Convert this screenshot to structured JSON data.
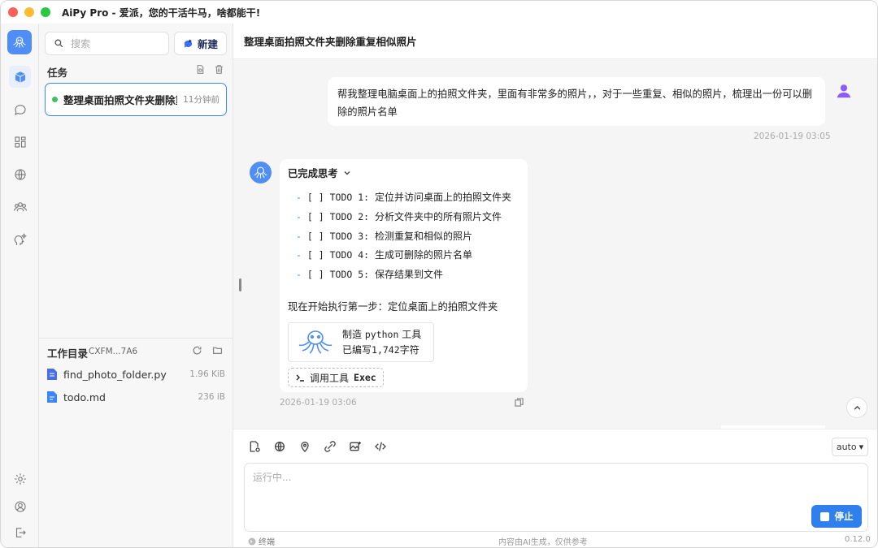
{
  "app": {
    "title": "AiPy Pro - 爱派，您的干活牛马，啥都能干!"
  },
  "sidebar": {
    "search_placeholder": "搜索",
    "new_label": "新建",
    "tasks_title": "任务",
    "tasks": [
      {
        "name": "整理桌面拍照文件夹删除重复相似照片",
        "time": "11分钟前",
        "status_color": "#3fbf5f"
      }
    ],
    "workdir": {
      "title": "工作目录",
      "path": "CXFM...7A6",
      "files": [
        {
          "name": "find_photo_folder.py",
          "size": "1.96 KiB"
        },
        {
          "name": "todo.md",
          "size": "236 iB"
        }
      ]
    }
  },
  "chat": {
    "title": "整理桌面拍照文件夹删除重复相似照片",
    "user_message": {
      "text": "帮我整理电脑桌面上的拍照文件夹，里面有非常多的照片，，对于一些重复、相似的照片，梳理出一份可以删除的照片名单",
      "timestamp": "2026-01-19 03:05"
    },
    "ai_message": {
      "thinking_label": "已完成思考",
      "todos": [
        {
          "prefix": "TODO 1:",
          "text": "定位并访问桌面上的拍照文件夹"
        },
        {
          "prefix": "TODO 2:",
          "text": "分析文件夹中的所有照片文件"
        },
        {
          "prefix": "TODO 3:",
          "text": "检测重复和相似的照片"
        },
        {
          "prefix": "TODO 4:",
          "text": "生成可删除的照片名单"
        },
        {
          "prefix": "TODO 5:",
          "text": "保存结果到文件"
        }
      ],
      "todo_dash": "-",
      "todo_box": "[ ]",
      "step_text": "现在开始执行第一步：定位桌面上的拍照文件夹",
      "tool_card": {
        "line1_prefix": "制造",
        "line1_lang": "python",
        "line1_suffix": "工具",
        "line2_prefix": "已编写",
        "line2_count": "1,742",
        "line2_suffix": "字符"
      },
      "exec_prefix": "调用工具",
      "exec_name": "Exec",
      "timestamp": "2026-01-19 03:06"
    }
  },
  "composer": {
    "placeholder": "运行中...",
    "mode": "auto",
    "stop_label": "停止",
    "terminal_label": "终端",
    "disclaimer": "内容由AI生成，仅供参考",
    "version": "0.12.0"
  },
  "colors": {
    "accent": "#2f80ed",
    "active_border": "#3a86f7",
    "running_dot": "#3fbf5f"
  }
}
